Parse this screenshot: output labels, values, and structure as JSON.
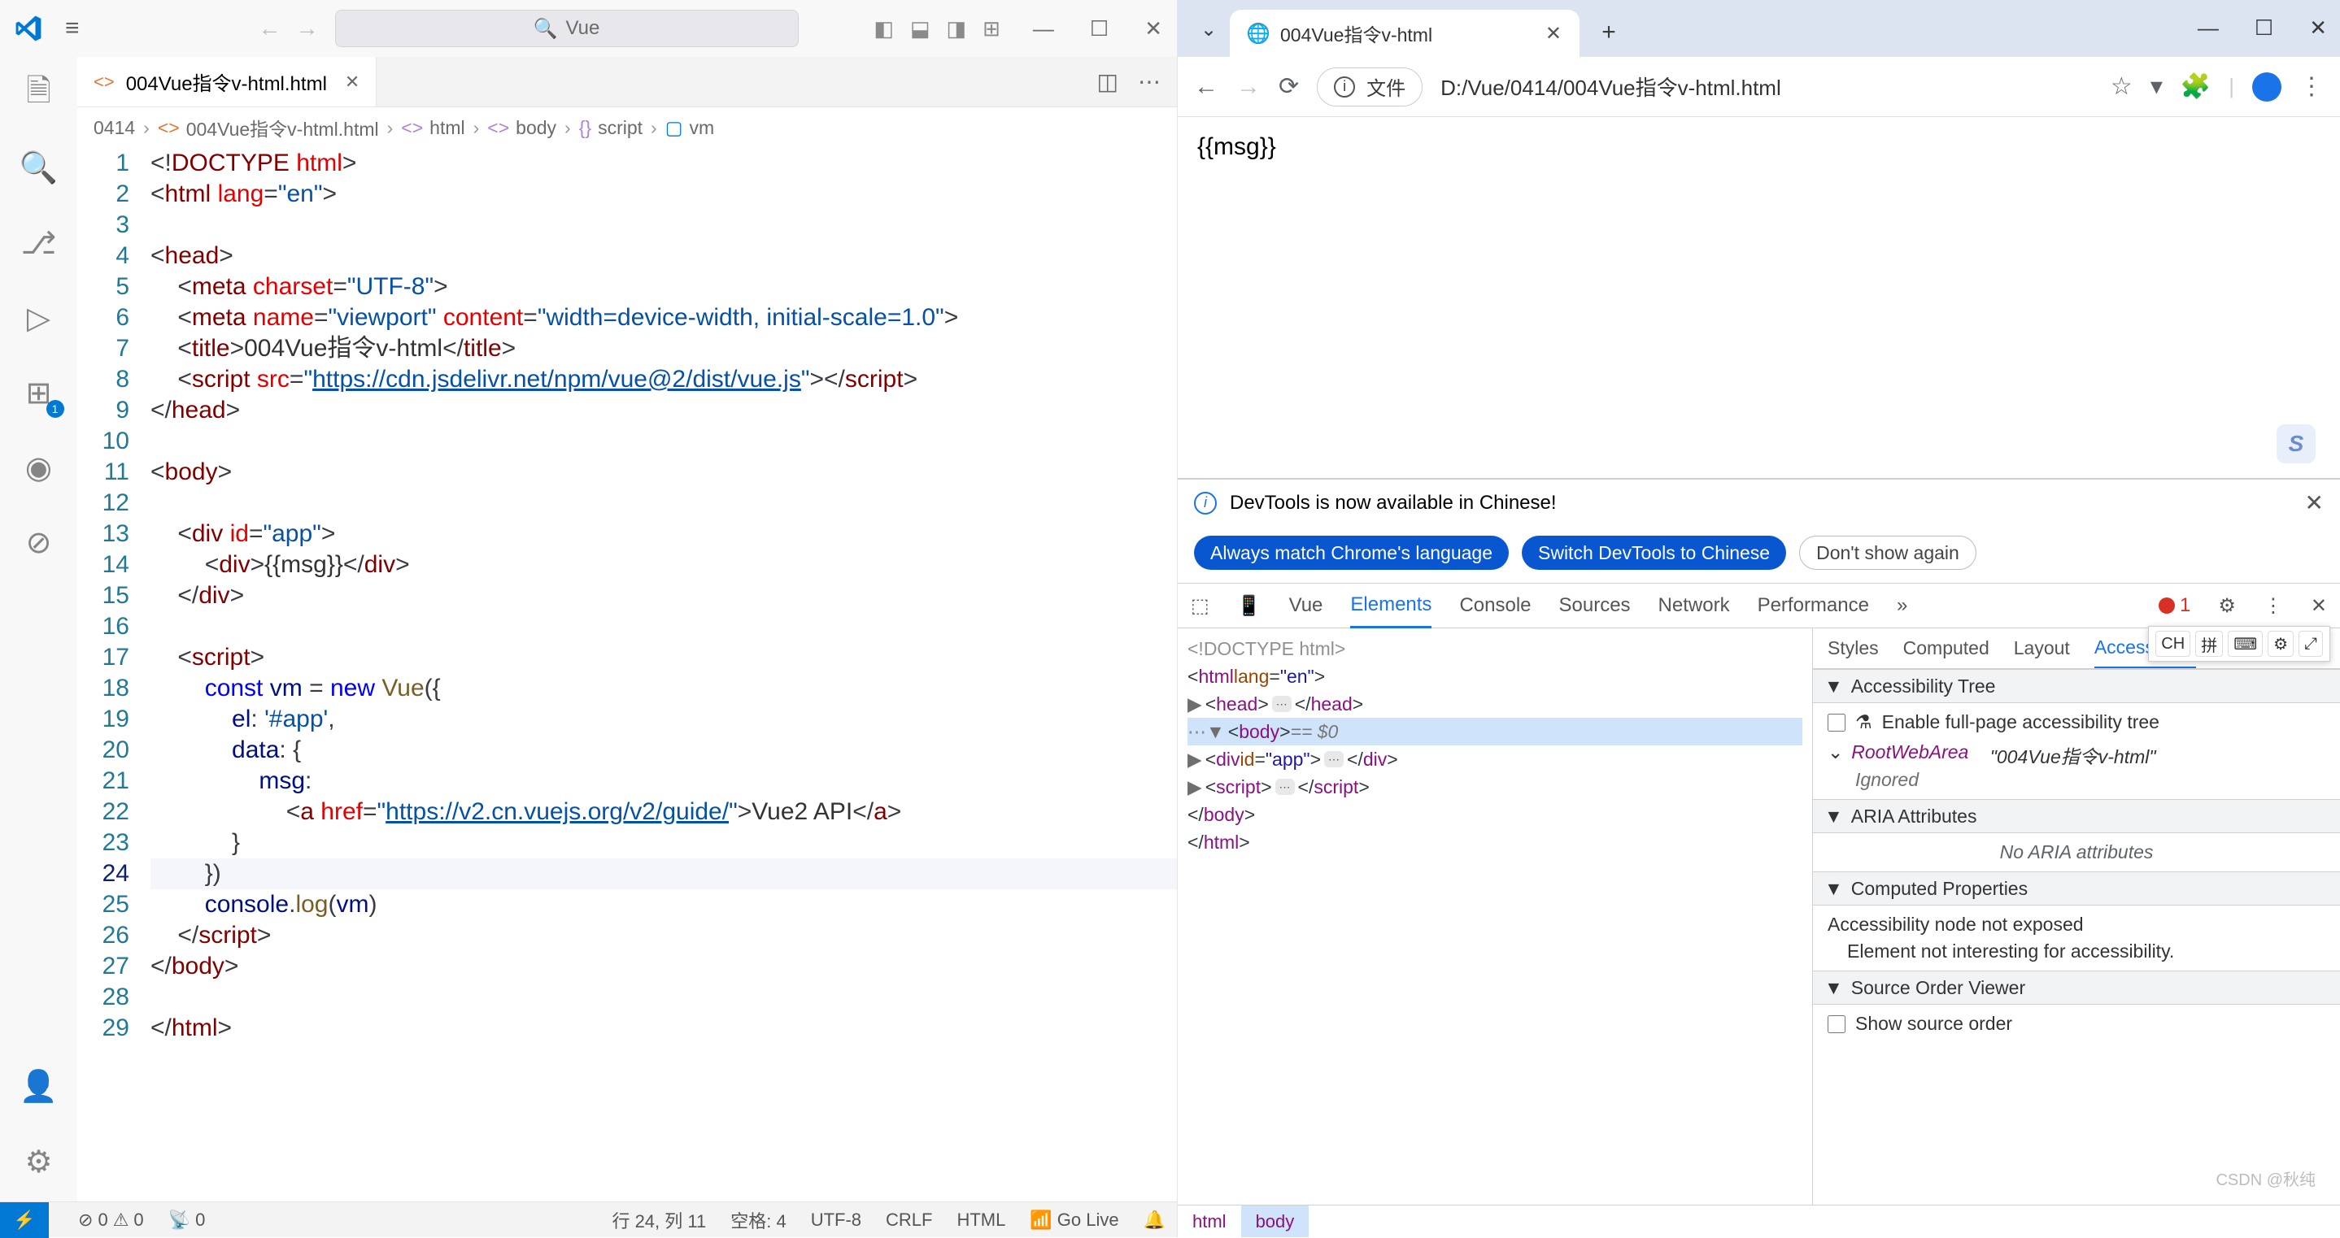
{
  "vscode": {
    "search_placeholder": "Vue",
    "tab": {
      "label": "004Vue指令v-html.html"
    },
    "breadcrumb": [
      "0414",
      "004Vue指令v-html.html",
      "html",
      "body",
      "script",
      "vm"
    ],
    "ext_badge": "1",
    "statusbar": {
      "errors": "0",
      "warnings": "0",
      "ports": "0",
      "cursor": "行 24, 列 11",
      "spaces": "空格: 4",
      "enc": "UTF-8",
      "eol": "CRLF",
      "lang": "HTML",
      "golive": "Go Live"
    },
    "code": {
      "current_line": 24,
      "lines": [
        {
          "n": 1,
          "seg": [
            [
              "pun",
              "<!"
            ],
            [
              "doct",
              "DOCTYPE"
            ],
            [
              "txt",
              " "
            ],
            [
              "attr",
              "html"
            ],
            [
              "pun",
              ">"
            ]
          ]
        },
        {
          "n": 2,
          "seg": [
            [
              "pun",
              "<"
            ],
            [
              "tag",
              "html"
            ],
            [
              "txt",
              " "
            ],
            [
              "attr",
              "lang"
            ],
            [
              "pun",
              "="
            ],
            [
              "str",
              "\"en\""
            ],
            [
              "pun",
              ">"
            ]
          ]
        },
        {
          "n": 3,
          "seg": []
        },
        {
          "n": 4,
          "seg": [
            [
              "pun",
              "<"
            ],
            [
              "tag",
              "head"
            ],
            [
              "pun",
              ">"
            ]
          ]
        },
        {
          "n": 5,
          "indent": 1,
          "seg": [
            [
              "pun",
              "<"
            ],
            [
              "tag",
              "meta"
            ],
            [
              "txt",
              " "
            ],
            [
              "attr",
              "charset"
            ],
            [
              "pun",
              "="
            ],
            [
              "str",
              "\"UTF-8\""
            ],
            [
              "pun",
              ">"
            ]
          ]
        },
        {
          "n": 6,
          "indent": 1,
          "seg": [
            [
              "pun",
              "<"
            ],
            [
              "tag",
              "meta"
            ],
            [
              "txt",
              " "
            ],
            [
              "attr",
              "name"
            ],
            [
              "pun",
              "="
            ],
            [
              "str",
              "\"viewport\""
            ],
            [
              "txt",
              " "
            ],
            [
              "attr",
              "content"
            ],
            [
              "pun",
              "="
            ],
            [
              "str",
              "\"width=device-width, initial-scale=1.0\""
            ],
            [
              "pun",
              ">"
            ]
          ]
        },
        {
          "n": 7,
          "indent": 1,
          "seg": [
            [
              "pun",
              "<"
            ],
            [
              "tag",
              "title"
            ],
            [
              "pun",
              ">"
            ],
            [
              "txt",
              "004Vue指令v-html"
            ],
            [
              "pun",
              "</"
            ],
            [
              "tag",
              "title"
            ],
            [
              "pun",
              ">"
            ]
          ]
        },
        {
          "n": 8,
          "indent": 1,
          "seg": [
            [
              "pun",
              "<"
            ],
            [
              "tag",
              "script"
            ],
            [
              "txt",
              " "
            ],
            [
              "attr",
              "src"
            ],
            [
              "pun",
              "="
            ],
            [
              "str",
              "\""
            ],
            [
              "url",
              "https://cdn.jsdelivr.net/npm/vue@2/dist/vue.js"
            ],
            [
              "str",
              "\""
            ],
            [
              "pun",
              "></"
            ],
            [
              "tag",
              "script"
            ],
            [
              "pun",
              ">"
            ]
          ]
        },
        {
          "n": 9,
          "seg": [
            [
              "pun",
              "</"
            ],
            [
              "tag",
              "head"
            ],
            [
              "pun",
              ">"
            ]
          ]
        },
        {
          "n": 10,
          "seg": []
        },
        {
          "n": 11,
          "seg": [
            [
              "pun",
              "<"
            ],
            [
              "tag",
              "body"
            ],
            [
              "pun",
              ">"
            ]
          ]
        },
        {
          "n": 12,
          "seg": []
        },
        {
          "n": 13,
          "indent": 1,
          "seg": [
            [
              "pun",
              "<"
            ],
            [
              "tag",
              "div"
            ],
            [
              "txt",
              " "
            ],
            [
              "attr",
              "id"
            ],
            [
              "pun",
              "="
            ],
            [
              "str",
              "\"app\""
            ],
            [
              "pun",
              ">"
            ]
          ]
        },
        {
          "n": 14,
          "indent": 2,
          "seg": [
            [
              "pun",
              "<"
            ],
            [
              "tag",
              "div"
            ],
            [
              "pun",
              ">"
            ],
            [
              "txt",
              "{{msg}}"
            ],
            [
              "pun",
              "</"
            ],
            [
              "tag",
              "div"
            ],
            [
              "pun",
              ">"
            ]
          ]
        },
        {
          "n": 15,
          "indent": 1,
          "seg": [
            [
              "pun",
              "</"
            ],
            [
              "tag",
              "div"
            ],
            [
              "pun",
              ">"
            ]
          ]
        },
        {
          "n": 16,
          "seg": []
        },
        {
          "n": 17,
          "indent": 1,
          "seg": [
            [
              "pun",
              "<"
            ],
            [
              "tag",
              "script"
            ],
            [
              "pun",
              ">"
            ]
          ]
        },
        {
          "n": 18,
          "indent": 2,
          "seg": [
            [
              "kw",
              "const"
            ],
            [
              "txt",
              " "
            ],
            [
              "var",
              "vm"
            ],
            [
              "txt",
              " "
            ],
            [
              "pun",
              "="
            ],
            [
              "txt",
              " "
            ],
            [
              "kw",
              "new"
            ],
            [
              "txt",
              " "
            ],
            [
              "fn",
              "Vue"
            ],
            [
              "pun",
              "({"
            ]
          ]
        },
        {
          "n": 19,
          "indent": 3,
          "seg": [
            [
              "var",
              "el"
            ],
            [
              "pun",
              ":"
            ],
            [
              "txt",
              " "
            ],
            [
              "str",
              "'#app'"
            ],
            [
              "pun",
              ","
            ]
          ]
        },
        {
          "n": 20,
          "indent": 3,
          "seg": [
            [
              "var",
              "data"
            ],
            [
              "pun",
              ":"
            ],
            [
              "txt",
              " "
            ],
            [
              "pun",
              "{"
            ]
          ]
        },
        {
          "n": 21,
          "indent": 4,
          "seg": [
            [
              "var",
              "msg"
            ],
            [
              "pun",
              ":"
            ]
          ]
        },
        {
          "n": 22,
          "indent": 5,
          "seg": [
            [
              "pun",
              "<"
            ],
            [
              "tag",
              "a"
            ],
            [
              "txt",
              " "
            ],
            [
              "attr",
              "href"
            ],
            [
              "pun",
              "="
            ],
            [
              "str",
              "\""
            ],
            [
              "url",
              "https://v2.cn.vuejs.org/v2/guide/"
            ],
            [
              "str",
              "\""
            ],
            [
              "pun",
              ">"
            ],
            [
              "txt",
              "Vue2 API"
            ],
            [
              "pun",
              "</"
            ],
            [
              "tag",
              "a"
            ],
            [
              "pun",
              ">"
            ]
          ]
        },
        {
          "n": 23,
          "indent": 3,
          "seg": [
            [
              "pun",
              "}"
            ]
          ]
        },
        {
          "n": 24,
          "indent": 2,
          "seg": [
            [
              "pun",
              "})"
            ]
          ]
        },
        {
          "n": 25,
          "indent": 2,
          "seg": [
            [
              "var",
              "console"
            ],
            [
              "pun",
              "."
            ],
            [
              "fn",
              "log"
            ],
            [
              "pun",
              "("
            ],
            [
              "var",
              "vm"
            ],
            [
              "pun",
              ")"
            ]
          ]
        },
        {
          "n": 26,
          "indent": 1,
          "seg": [
            [
              "pun",
              "</"
            ],
            [
              "tag",
              "script"
            ],
            [
              "pun",
              ">"
            ]
          ]
        },
        {
          "n": 27,
          "seg": [
            [
              "pun",
              "</"
            ],
            [
              "tag",
              "body"
            ],
            [
              "pun",
              ">"
            ]
          ]
        },
        {
          "n": 28,
          "seg": []
        },
        {
          "n": 29,
          "seg": [
            [
              "pun",
              "</"
            ],
            [
              "tag",
              "html"
            ],
            [
              "pun",
              ">"
            ]
          ]
        }
      ]
    }
  },
  "chrome": {
    "tab_title": "004Vue指令v-html",
    "addr_label": "文件",
    "addr_path": "D:/Vue/0414/004Vue指令v-html.html",
    "page_content": "{{msg}}",
    "devtools": {
      "info": "DevTools is now available in Chinese!",
      "btn_match": "Always match Chrome's language",
      "btn_switch": "Switch DevTools to Chinese",
      "btn_dont": "Don't show again",
      "tabs": [
        "Vue",
        "Elements",
        "Console",
        "Sources",
        "Network",
        "Performance"
      ],
      "active_tab": "Elements",
      "err_count": "1",
      "side_tabs": [
        "Styles",
        "Computed",
        "Layout",
        "Accessibility"
      ],
      "active_side": "Accessibility",
      "dom": [
        {
          "d": 0,
          "html": "<span class='gray'>&lt;!DOCTYPE html&gt;</span>"
        },
        {
          "d": 0,
          "html": "<span class='pun'>&lt;</span><span class='tag'>html</span> <span class='att'>lang</span>=<span class='val'>\"en\"</span><span class='pun'>&gt;</span>"
        },
        {
          "d": 1,
          "tri": "▶",
          "html": "<span class='pun'>&lt;</span><span class='tag'>head</span><span class='pun'>&gt;</span><span class='pill'>⋯</span><span class='pun'>&lt;/</span><span class='tag'>head</span><span class='pun'>&gt;</span>"
        },
        {
          "d": 1,
          "tri": "▼",
          "sel": true,
          "pre": "⋯",
          "html": "<span class='pun'>&lt;</span><span class='tag'>body</span><span class='pun'>&gt;</span> <span class='eq0'>== $0</span>"
        },
        {
          "d": 2,
          "tri": "▶",
          "html": "<span class='pun'>&lt;</span><span class='tag'>div</span> <span class='att'>id</span>=<span class='val'>\"app\"</span><span class='pun'>&gt;</span><span class='pill'>⋯</span><span class='pun'>&lt;/</span><span class='tag'>div</span><span class='pun'>&gt;</span>"
        },
        {
          "d": 2,
          "tri": "▶",
          "html": "<span class='pun'>&lt;</span><span class='tag'>script</span><span class='pun'>&gt;</span><span class='pill'>⋯</span><span class='pun'>&lt;/</span><span class='tag'>script</span><span class='pun'>&gt;</span>"
        },
        {
          "d": 1,
          "html": "<span class='pun'>&lt;/</span><span class='tag'>body</span><span class='pun'>&gt;</span>"
        },
        {
          "d": 0,
          "html": "<span class='pun'>&lt;/</span><span class='tag'>html</span><span class='pun'>&gt;</span>"
        }
      ],
      "crumbs": [
        "html",
        "body"
      ],
      "a11y": {
        "sec_tree": "Accessibility Tree",
        "enable_full": "Enable full-page accessibility tree",
        "root": "RootWebArea",
        "root_name": "\"004Vue指令v-html\"",
        "ignored": "Ignored",
        "sec_aria": "ARIA Attributes",
        "no_aria": "No ARIA attributes",
        "sec_comp": "Computed Properties",
        "not_exposed": "Accessibility node not exposed",
        "not_interesting": "Element not interesting for accessibility.",
        "sec_source": "Source Order Viewer",
        "show_source": "Show source order"
      }
    }
  },
  "ime": [
    "CH",
    "拼",
    "⌨",
    "⚙",
    "⤢"
  ],
  "watermark": "CSDN @秋纯"
}
